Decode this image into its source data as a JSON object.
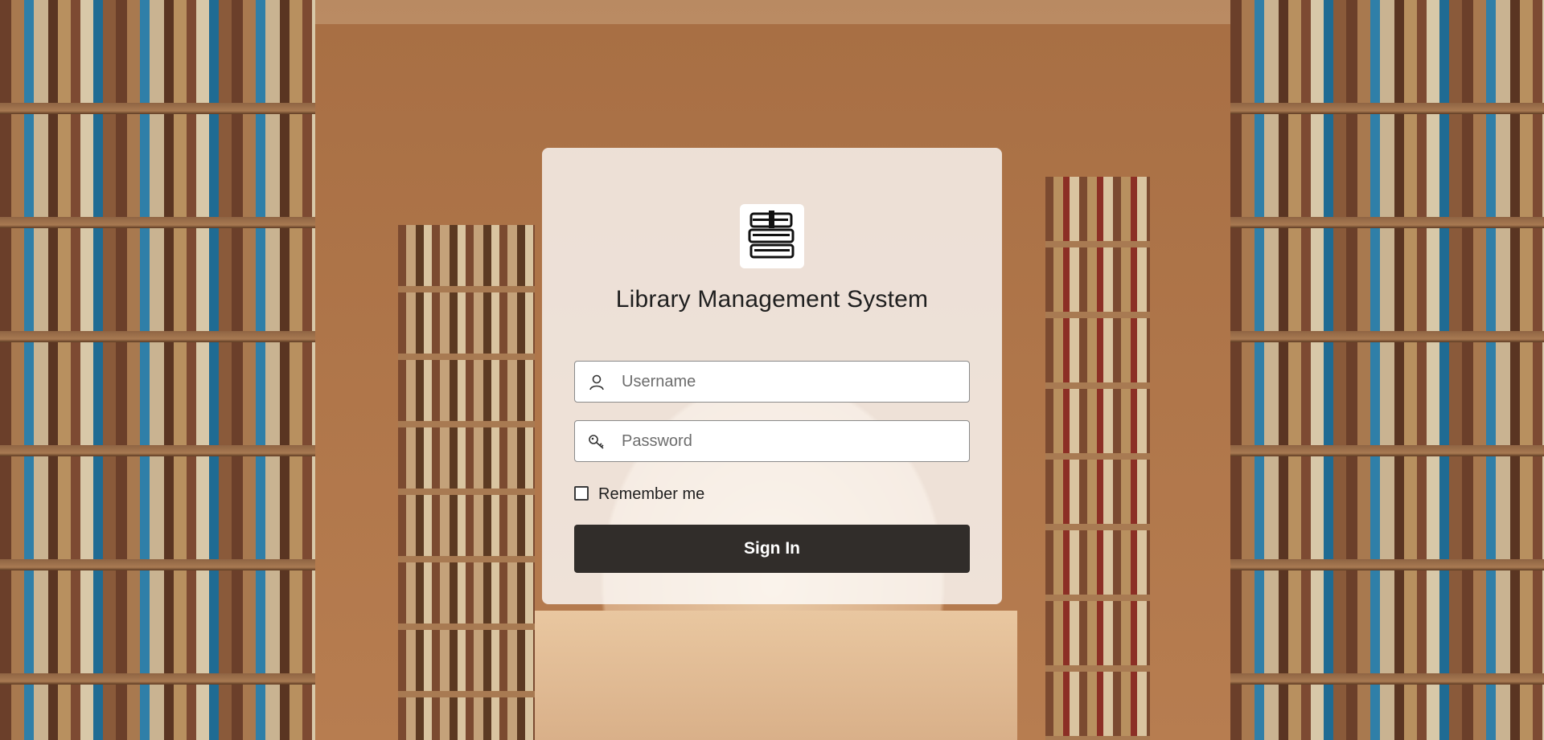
{
  "app": {
    "title": "Library Management System",
    "logo_icon": "books-stack-icon"
  },
  "login": {
    "username": {
      "icon": "user-icon",
      "placeholder": "Username",
      "value": ""
    },
    "password": {
      "icon": "key-icon",
      "placeholder": "Password",
      "value": ""
    },
    "remember_label": "Remember me",
    "remember_checked": false,
    "signin_label": "Sign In"
  },
  "colors": {
    "button_bg": "#312d2a",
    "button_text": "#ffffff",
    "card_bg": "rgba(255,255,255,0.78)"
  }
}
